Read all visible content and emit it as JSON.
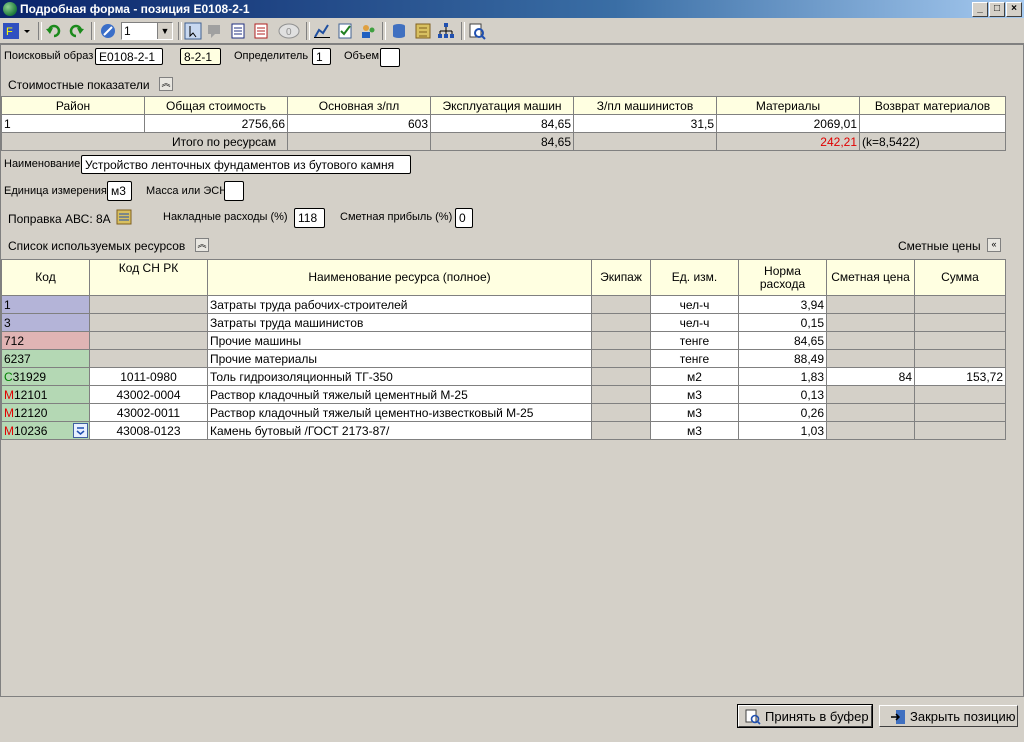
{
  "window": {
    "title": "Подробная форма - позиция E0108-2-1"
  },
  "toolbar": {
    "combo_value": "1"
  },
  "header": {
    "search_label": "Поисковый образ",
    "search_value": "E0108-2-1",
    "short_code": "8-2-1",
    "determinant_label": "Определитель",
    "determinant_value": "1",
    "volume_label": "Объем",
    "volume_value": ""
  },
  "cost": {
    "section_title": "Стоимостные показатели",
    "columns": [
      "Район",
      "Общая стоимость",
      "Основная з/пл",
      "Эксплуатация машин",
      "З/пл машинистов",
      "Материалы",
      "Возврат материалов"
    ],
    "row": [
      "1",
      "2756,66",
      "603",
      "84,65",
      "31,5",
      "2069,01",
      ""
    ],
    "total_label": "Итого по ресурсам",
    "total_machines": "84,65",
    "total_materials": "242,21",
    "total_k": "(k=8,5422)"
  },
  "details": {
    "name_label": "Наименование",
    "name_value": "Устройство ленточных фундаментов из бутового камня",
    "unit_label": "Единица измерения",
    "unit_value": "м3",
    "mass_label": "Масса или ЭСН",
    "mass_value": "",
    "abc_label": "Поправка АВС: 8А",
    "overhead_label": "Накладные расходы (%)",
    "overhead_value": "118",
    "profit_label": "Сметная прибыль (%)",
    "profit_value": "0"
  },
  "resources": {
    "section_title": "Список используемых ресурсов",
    "prices_label": "Сметные цены",
    "columns": [
      "Код",
      "Код СН РК",
      "Наименование ресурса (полное)",
      "Экипаж",
      "Ед. изм.",
      "Норма расхода",
      "Сметная цена",
      "Сумма"
    ],
    "rows": [
      {
        "prefix": "",
        "code": "1",
        "snrk": "",
        "name": "Затраты труда рабочих-строителей",
        "crew": "",
        "unit": "чел-ч",
        "norm": "3,94",
        "price": "",
        "sum": ""
      },
      {
        "prefix": "",
        "code": "3",
        "snrk": "",
        "name": "Затраты труда машинистов",
        "crew": "",
        "unit": "чел-ч",
        "norm": "0,15",
        "price": "",
        "sum": ""
      },
      {
        "prefix": "",
        "code": "712",
        "snrk": "",
        "name": "Прочие машины",
        "crew": "",
        "unit": "тенге",
        "norm": "84,65",
        "price": "",
        "sum": ""
      },
      {
        "prefix": "",
        "code": "6237",
        "snrk": "",
        "name": "Прочие материалы",
        "crew": "",
        "unit": "тенге",
        "norm": "88,49",
        "price": "",
        "sum": ""
      },
      {
        "prefix": "С",
        "code": "31929",
        "snrk": "1011-0980",
        "name": "Толь гидроизоляционный ТГ-350",
        "crew": "",
        "unit": "м2",
        "norm": "1,83",
        "price": "84",
        "sum": "153,72"
      },
      {
        "prefix": "М",
        "code": "12101",
        "snrk": "43002-0004",
        "name": "Раствор кладочный тяжелый цементный М-25",
        "crew": "",
        "unit": "м3",
        "norm": "0,13",
        "price": "",
        "sum": ""
      },
      {
        "prefix": "М",
        "code": "12120",
        "snrk": "43002-0011",
        "name": "Раствор кладочный тяжелый цементно-известковый М-25",
        "crew": "",
        "unit": "м3",
        "norm": "0,26",
        "price": "",
        "sum": ""
      },
      {
        "prefix": "М",
        "code": "10236",
        "snrk": "43008-0123",
        "name": "Камень бутовый /ГОСТ 2173-87/",
        "crew": "",
        "unit": "м3",
        "norm": "1,03",
        "price": "",
        "sum": ""
      }
    ]
  },
  "footer": {
    "accept_label": "Принять в буфер",
    "close_label": "Закрыть позицию"
  },
  "colors": {
    "code_labor": "#b4b4d8",
    "code_machine": "#e0b4b4",
    "code_material": "#b4d8b4",
    "header_bg": "#ffffe1",
    "highlight_red": "#e00000"
  }
}
